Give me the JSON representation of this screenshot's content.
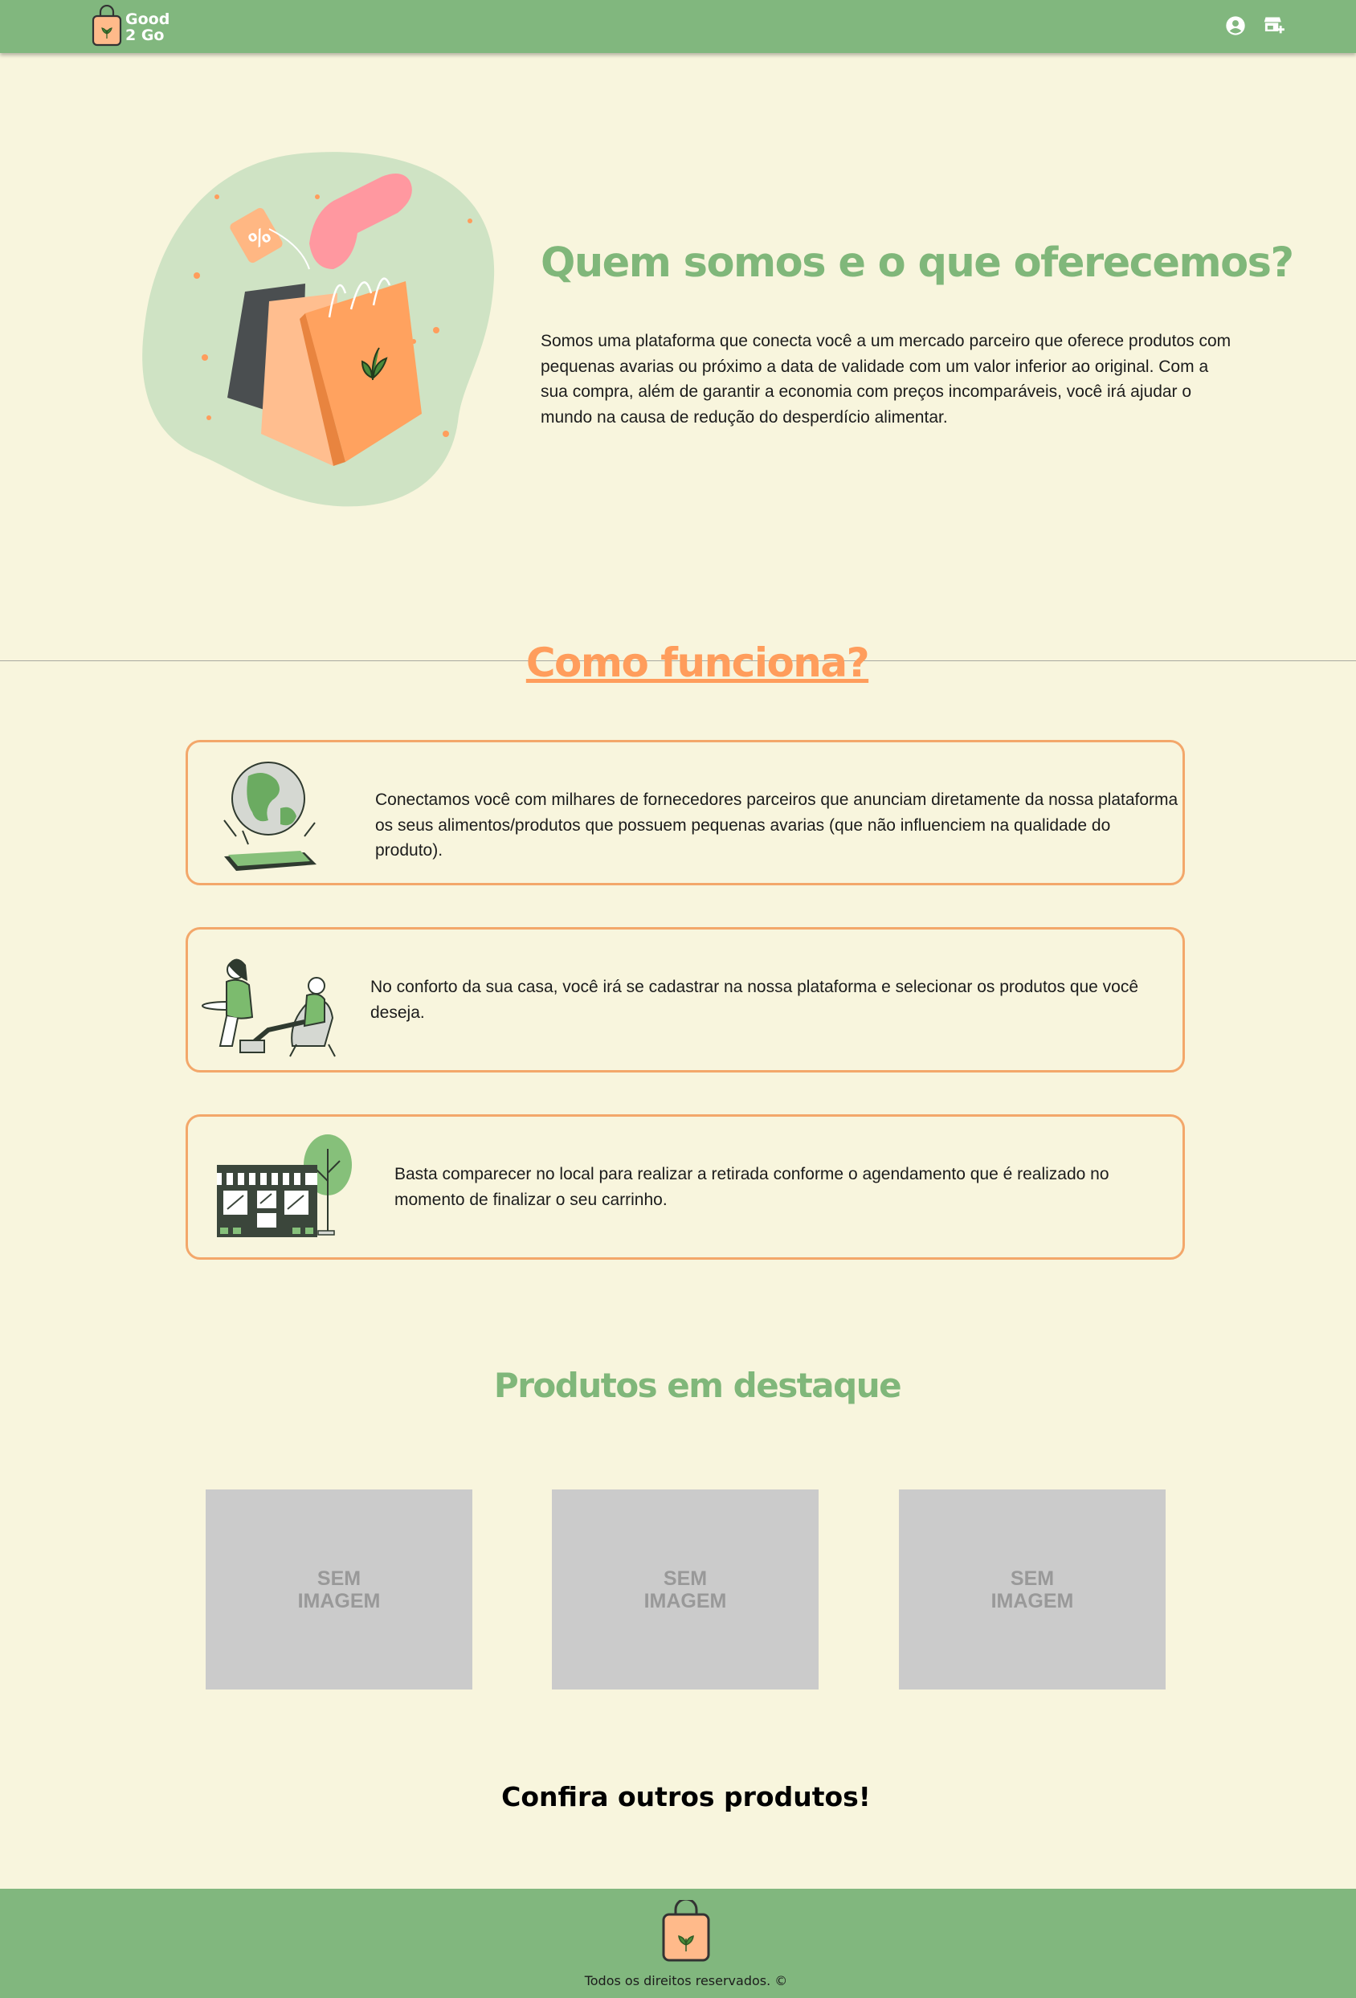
{
  "header": {
    "brand": [
      "Good",
      "2 Go"
    ],
    "account_icon": "account-circle-icon",
    "store_icon": "store-icon"
  },
  "hero": {
    "title": "Quem somos e o que oferecemos?",
    "text": "Somos uma plataforma que conecta você a um mercado parceiro que oferece produtos com pequenas avarias ou próximo a data de validade com um valor inferior ao original. Com a sua compra, além de garantir a economia com preços incomparáveis, você irá ajudar o mundo na causa de redução do desperdício alimentar.",
    "image": "shopping-bags-illustration"
  },
  "how": {
    "title": "Como funciona?",
    "cards": [
      {
        "icon": "globe-phone-illustration",
        "text": "Conectamos você com milhares de fornecedores parceiros que anunciam diretamente da nossa plataforma os seus alimentos/produtos que possuem pequenas avarias (que não influenciem na qualidade do produto)."
      },
      {
        "icon": "people-at-home-illustration",
        "text": "No conforto da sua casa, você irá se cadastrar na nossa plataforma e selecionar os produtos que você deseja."
      },
      {
        "icon": "storefront-illustration",
        "text": "Basta comparecer no local para realizar a retirada conforme o agendamento que é realizado no momento de finalizar o seu carrinho."
      }
    ]
  },
  "products": {
    "title": "Produtos em destaque",
    "items": [
      {
        "placeholder": "SEM\nIMAGEM"
      },
      {
        "placeholder": "SEM\nIMAGEM"
      },
      {
        "placeholder": "SEM\nIMAGEM"
      }
    ],
    "more": "Confira outros produtos!"
  },
  "footer": {
    "text": "Todos os direitos reservados. ©"
  },
  "colors": {
    "header_bg": "#81b77e",
    "page_bg": "#f8f5dd",
    "accent_green": "#80b77a",
    "accent_orange": "#ff9d5c",
    "card_border": "#f3a76a"
  }
}
